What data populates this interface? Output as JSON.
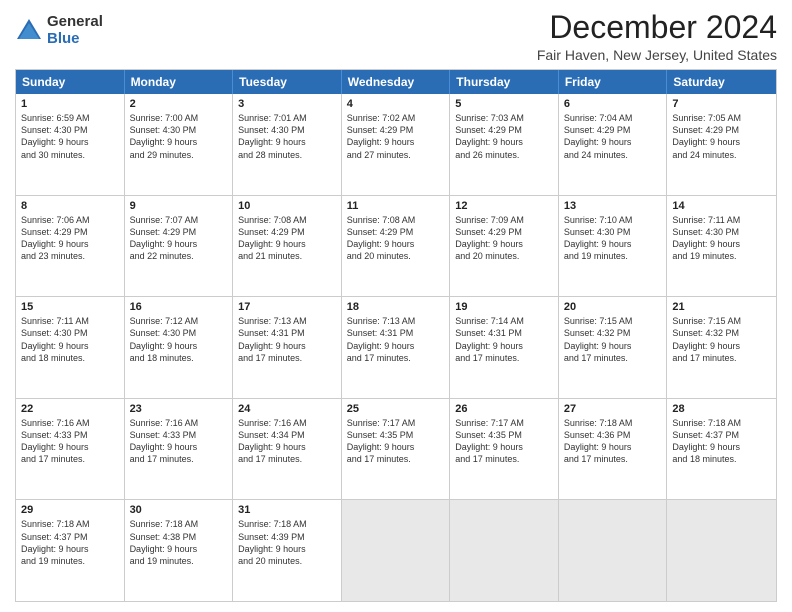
{
  "header": {
    "logo": {
      "general": "General",
      "blue": "Blue"
    },
    "title": "December 2024",
    "location": "Fair Haven, New Jersey, United States"
  },
  "weekdays": [
    "Sunday",
    "Monday",
    "Tuesday",
    "Wednesday",
    "Thursday",
    "Friday",
    "Saturday"
  ],
  "weeks": [
    [
      {
        "day": "1",
        "lines": [
          "Sunrise: 6:59 AM",
          "Sunset: 4:30 PM",
          "Daylight: 9 hours",
          "and 30 minutes."
        ]
      },
      {
        "day": "2",
        "lines": [
          "Sunrise: 7:00 AM",
          "Sunset: 4:30 PM",
          "Daylight: 9 hours",
          "and 29 minutes."
        ]
      },
      {
        "day": "3",
        "lines": [
          "Sunrise: 7:01 AM",
          "Sunset: 4:30 PM",
          "Daylight: 9 hours",
          "and 28 minutes."
        ]
      },
      {
        "day": "4",
        "lines": [
          "Sunrise: 7:02 AM",
          "Sunset: 4:29 PM",
          "Daylight: 9 hours",
          "and 27 minutes."
        ]
      },
      {
        "day": "5",
        "lines": [
          "Sunrise: 7:03 AM",
          "Sunset: 4:29 PM",
          "Daylight: 9 hours",
          "and 26 minutes."
        ]
      },
      {
        "day": "6",
        "lines": [
          "Sunrise: 7:04 AM",
          "Sunset: 4:29 PM",
          "Daylight: 9 hours",
          "and 24 minutes."
        ]
      },
      {
        "day": "7",
        "lines": [
          "Sunrise: 7:05 AM",
          "Sunset: 4:29 PM",
          "Daylight: 9 hours",
          "and 24 minutes."
        ]
      }
    ],
    [
      {
        "day": "8",
        "lines": [
          "Sunrise: 7:06 AM",
          "Sunset: 4:29 PM",
          "Daylight: 9 hours",
          "and 23 minutes."
        ]
      },
      {
        "day": "9",
        "lines": [
          "Sunrise: 7:07 AM",
          "Sunset: 4:29 PM",
          "Daylight: 9 hours",
          "and 22 minutes."
        ]
      },
      {
        "day": "10",
        "lines": [
          "Sunrise: 7:08 AM",
          "Sunset: 4:29 PM",
          "Daylight: 9 hours",
          "and 21 minutes."
        ]
      },
      {
        "day": "11",
        "lines": [
          "Sunrise: 7:08 AM",
          "Sunset: 4:29 PM",
          "Daylight: 9 hours",
          "and 20 minutes."
        ]
      },
      {
        "day": "12",
        "lines": [
          "Sunrise: 7:09 AM",
          "Sunset: 4:29 PM",
          "Daylight: 9 hours",
          "and 20 minutes."
        ]
      },
      {
        "day": "13",
        "lines": [
          "Sunrise: 7:10 AM",
          "Sunset: 4:30 PM",
          "Daylight: 9 hours",
          "and 19 minutes."
        ]
      },
      {
        "day": "14",
        "lines": [
          "Sunrise: 7:11 AM",
          "Sunset: 4:30 PM",
          "Daylight: 9 hours",
          "and 19 minutes."
        ]
      }
    ],
    [
      {
        "day": "15",
        "lines": [
          "Sunrise: 7:11 AM",
          "Sunset: 4:30 PM",
          "Daylight: 9 hours",
          "and 18 minutes."
        ]
      },
      {
        "day": "16",
        "lines": [
          "Sunrise: 7:12 AM",
          "Sunset: 4:30 PM",
          "Daylight: 9 hours",
          "and 18 minutes."
        ]
      },
      {
        "day": "17",
        "lines": [
          "Sunrise: 7:13 AM",
          "Sunset: 4:31 PM",
          "Daylight: 9 hours",
          "and 17 minutes."
        ]
      },
      {
        "day": "18",
        "lines": [
          "Sunrise: 7:13 AM",
          "Sunset: 4:31 PM",
          "Daylight: 9 hours",
          "and 17 minutes."
        ]
      },
      {
        "day": "19",
        "lines": [
          "Sunrise: 7:14 AM",
          "Sunset: 4:31 PM",
          "Daylight: 9 hours",
          "and 17 minutes."
        ]
      },
      {
        "day": "20",
        "lines": [
          "Sunrise: 7:15 AM",
          "Sunset: 4:32 PM",
          "Daylight: 9 hours",
          "and 17 minutes."
        ]
      },
      {
        "day": "21",
        "lines": [
          "Sunrise: 7:15 AM",
          "Sunset: 4:32 PM",
          "Daylight: 9 hours",
          "and 17 minutes."
        ]
      }
    ],
    [
      {
        "day": "22",
        "lines": [
          "Sunrise: 7:16 AM",
          "Sunset: 4:33 PM",
          "Daylight: 9 hours",
          "and 17 minutes."
        ]
      },
      {
        "day": "23",
        "lines": [
          "Sunrise: 7:16 AM",
          "Sunset: 4:33 PM",
          "Daylight: 9 hours",
          "and 17 minutes."
        ]
      },
      {
        "day": "24",
        "lines": [
          "Sunrise: 7:16 AM",
          "Sunset: 4:34 PM",
          "Daylight: 9 hours",
          "and 17 minutes."
        ]
      },
      {
        "day": "25",
        "lines": [
          "Sunrise: 7:17 AM",
          "Sunset: 4:35 PM",
          "Daylight: 9 hours",
          "and 17 minutes."
        ]
      },
      {
        "day": "26",
        "lines": [
          "Sunrise: 7:17 AM",
          "Sunset: 4:35 PM",
          "Daylight: 9 hours",
          "and 17 minutes."
        ]
      },
      {
        "day": "27",
        "lines": [
          "Sunrise: 7:18 AM",
          "Sunset: 4:36 PM",
          "Daylight: 9 hours",
          "and 17 minutes."
        ]
      },
      {
        "day": "28",
        "lines": [
          "Sunrise: 7:18 AM",
          "Sunset: 4:37 PM",
          "Daylight: 9 hours",
          "and 18 minutes."
        ]
      }
    ],
    [
      {
        "day": "29",
        "lines": [
          "Sunrise: 7:18 AM",
          "Sunset: 4:37 PM",
          "Daylight: 9 hours",
          "and 19 minutes."
        ]
      },
      {
        "day": "30",
        "lines": [
          "Sunrise: 7:18 AM",
          "Sunset: 4:38 PM",
          "Daylight: 9 hours",
          "and 19 minutes."
        ]
      },
      {
        "day": "31",
        "lines": [
          "Sunrise: 7:18 AM",
          "Sunset: 4:39 PM",
          "Daylight: 9 hours",
          "and 20 minutes."
        ]
      },
      {
        "day": "",
        "lines": []
      },
      {
        "day": "",
        "lines": []
      },
      {
        "day": "",
        "lines": []
      },
      {
        "day": "",
        "lines": []
      }
    ]
  ]
}
